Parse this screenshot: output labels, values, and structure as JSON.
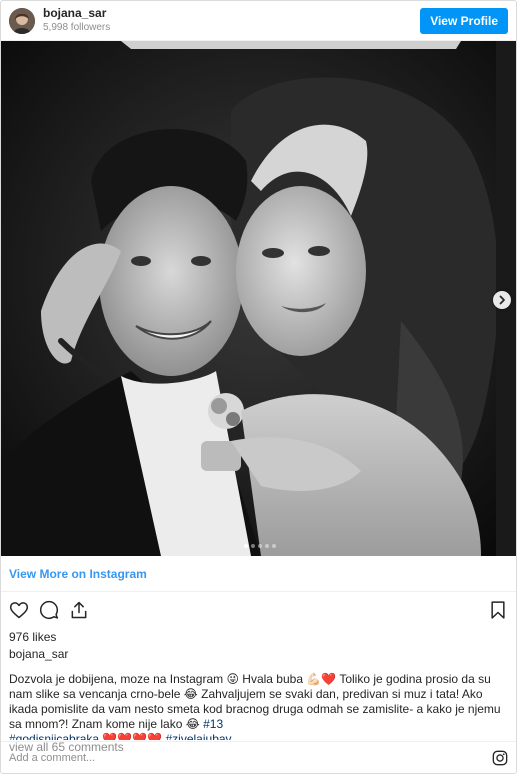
{
  "header": {
    "username": "bojana_sar",
    "followers": "5,998 followers",
    "view_profile": "View Profile",
    "avatar_icon": "profile-avatar"
  },
  "post": {
    "image_description_icon": "wedding-photo",
    "carousel_next_icon": "chevron-right-icon",
    "dots_count": 5,
    "active_dot": 1
  },
  "view_more": "View More on Instagram",
  "actions": {
    "like_icon": "heart-icon",
    "comment_icon": "comment-icon",
    "share_icon": "share-icon",
    "save_icon": "bookmark-icon"
  },
  "likes": "976 likes",
  "caption": {
    "username": "bojana_sar",
    "part1": "Dozvola je dobijena, moze na Instagram 😜 Hvala buba 💪🏻❤️ Toliko je godina prosio da su nam slike sa vencanja crno-bele 😂 Zahvaljujem se svaki dan, predivan si muz i tata! Ako ikada pomislite da vam nesto smeta kod bracnog druga odmah se zamislite- a kako je njemu sa mnom?! Znam kome nije lako 😂 ",
    "tag1": "#13",
    "tag2": "#godisnjicabraka",
    "hearts": " ❤️❤️❤️❤️ ",
    "tag3": "#zivelajubav"
  },
  "comments_link": "view all 65 comments",
  "add_comment_placeholder": "Add a comment...",
  "colors": {
    "accent": "#0095f6",
    "link": "#3897f0",
    "text": "#262626",
    "muted": "#8e8e8e",
    "hashtag": "#00376b"
  }
}
